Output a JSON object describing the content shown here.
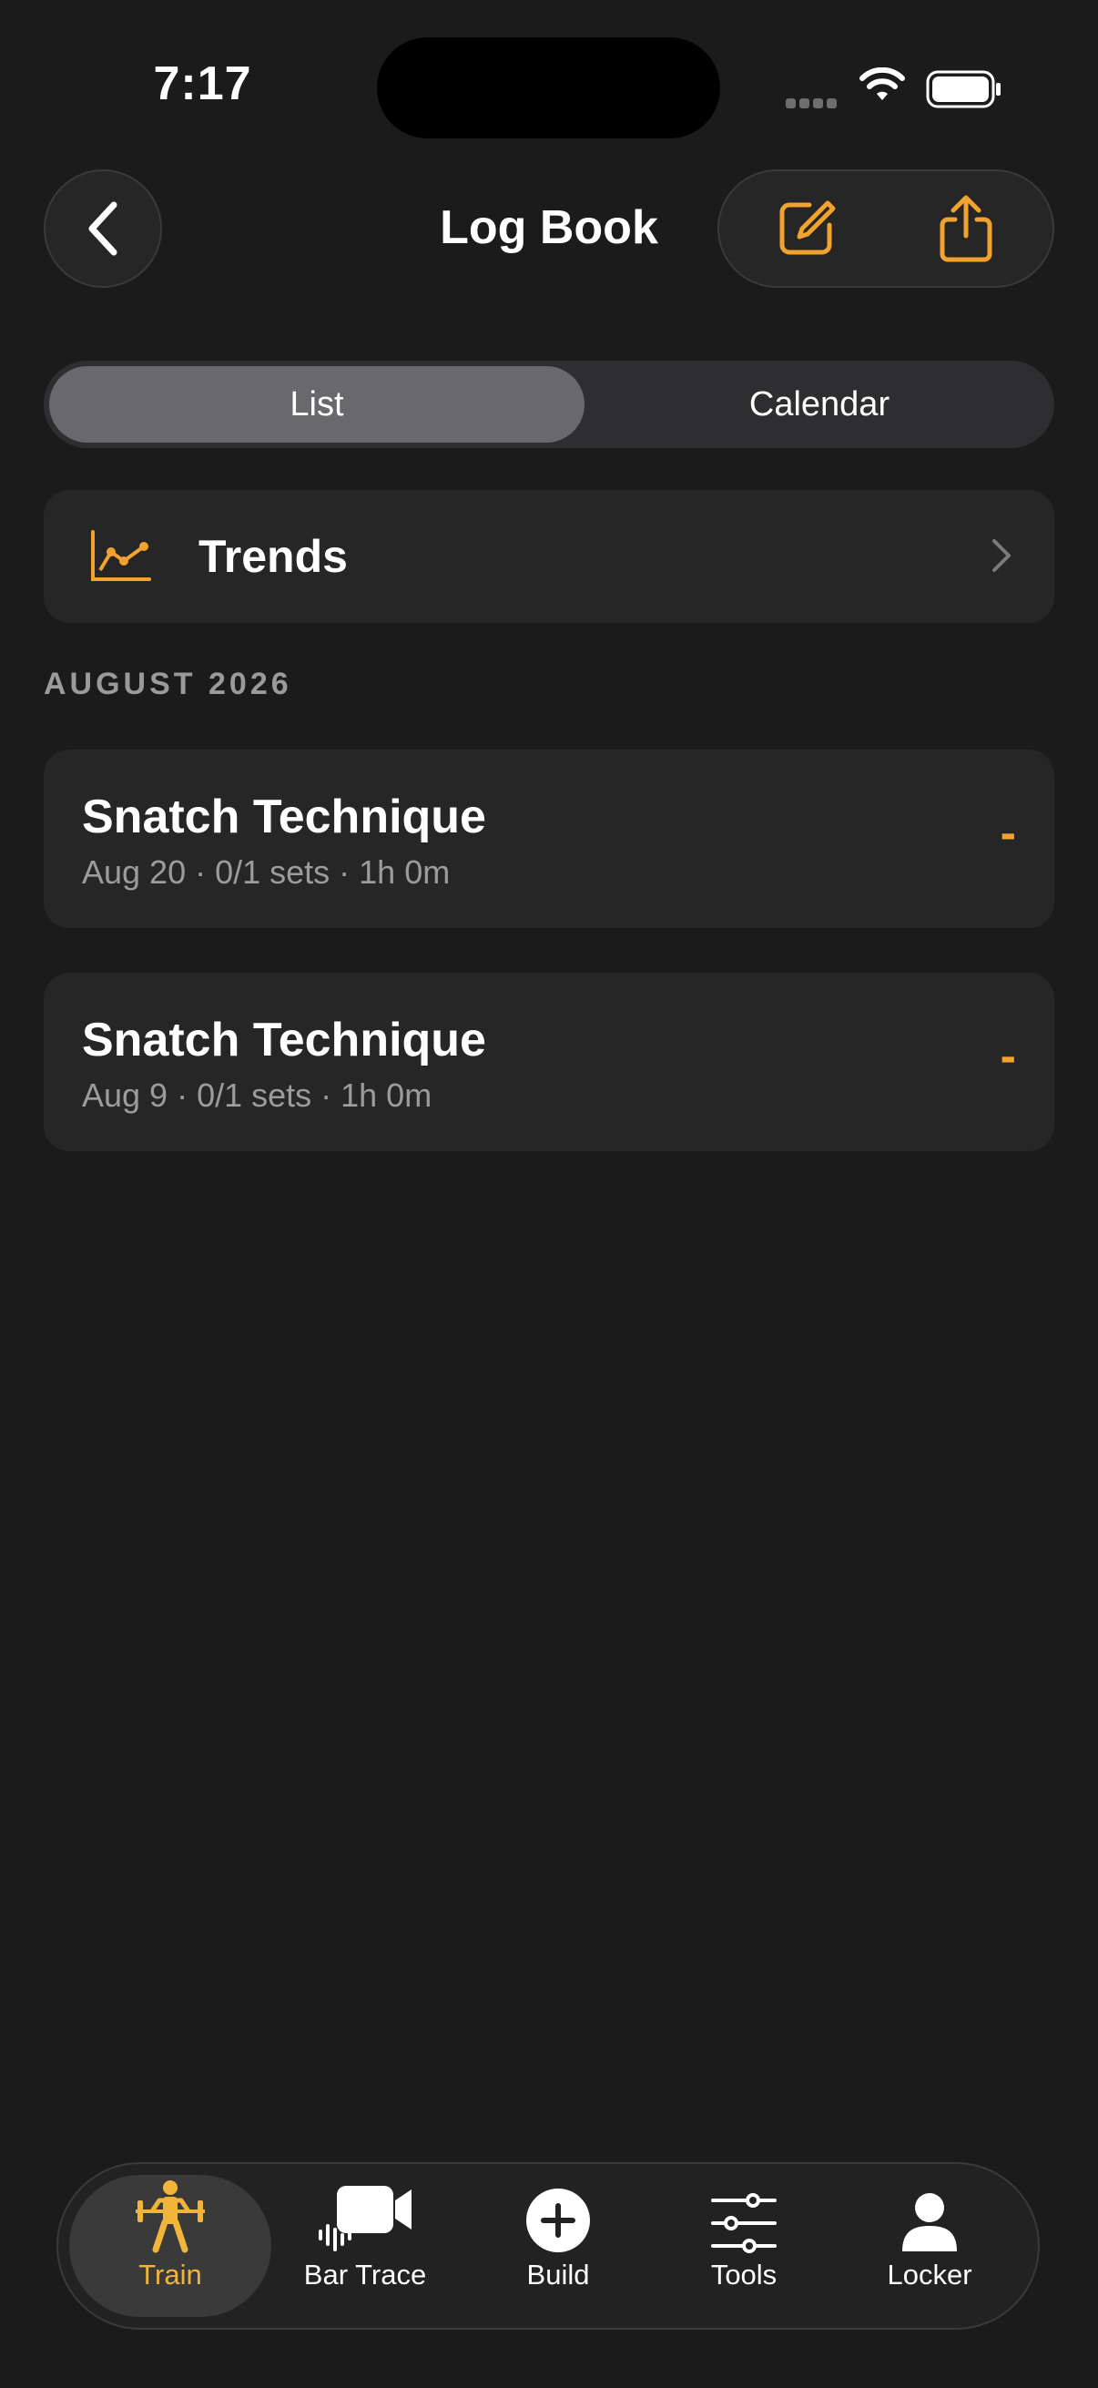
{
  "status_bar": {
    "time": "7:17"
  },
  "header": {
    "title": "Log Book"
  },
  "segmented": {
    "list_label": "List",
    "calendar_label": "Calendar",
    "selected": "List"
  },
  "trends": {
    "label": "Trends"
  },
  "section": {
    "header": "AUGUST 2026"
  },
  "workouts": [
    {
      "title": "Snatch Technique",
      "subtitle": "Aug 20 · 0/1 sets · 1h 0m",
      "value": "-"
    },
    {
      "title": "Snatch Technique",
      "subtitle": "Aug 9 · 0/1 sets · 1h 0m",
      "value": "-"
    }
  ],
  "tabbar": {
    "items": [
      {
        "label": "Train",
        "icon": "weightlifter-icon",
        "active": true
      },
      {
        "label": "Bar Trace",
        "icon": "video-camera-icon",
        "active": false
      },
      {
        "label": "Build",
        "icon": "plus-circle-icon",
        "active": false
      },
      {
        "label": "Tools",
        "icon": "sliders-icon",
        "active": false
      },
      {
        "label": "Locker",
        "icon": "person-icon",
        "active": false
      }
    ]
  },
  "colors": {
    "accent": "#f2a32d",
    "background": "#1b1b1b",
    "card": "#262626"
  }
}
